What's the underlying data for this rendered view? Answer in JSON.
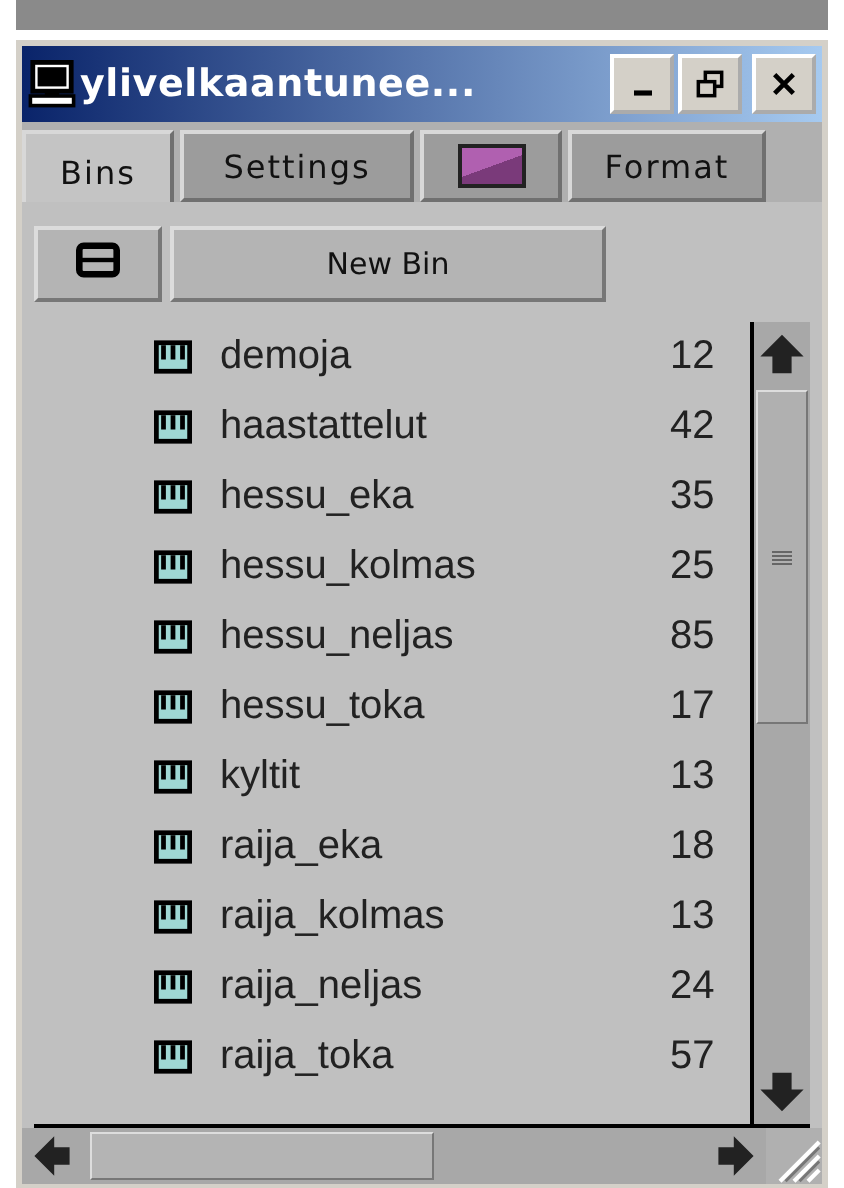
{
  "window": {
    "title": "ylivelkaantunee..."
  },
  "tabs": [
    {
      "kind": "text",
      "label": "Bins",
      "selected": true
    },
    {
      "kind": "text",
      "label": "Settings",
      "selected": false
    },
    {
      "kind": "icon",
      "selected": false
    },
    {
      "kind": "text",
      "label": "Format",
      "selected": false
    }
  ],
  "toolbar": {
    "new_bin_button": "New Bin"
  },
  "bins": [
    {
      "name": "demoja",
      "size": "12"
    },
    {
      "name": "haastattelut",
      "size": "42"
    },
    {
      "name": "hessu_eka",
      "size": "35"
    },
    {
      "name": "hessu_kolmas",
      "size": "25"
    },
    {
      "name": "hessu_neljas",
      "size": "85"
    },
    {
      "name": "hessu_toka",
      "size": "17"
    },
    {
      "name": "kyltit",
      "size": "13"
    },
    {
      "name": "raija_eka",
      "size": "18"
    },
    {
      "name": "raija_kolmas",
      "size": "13"
    },
    {
      "name": "raija_neljas",
      "size": "24"
    },
    {
      "name": "raija_toka",
      "size": "57"
    }
  ]
}
